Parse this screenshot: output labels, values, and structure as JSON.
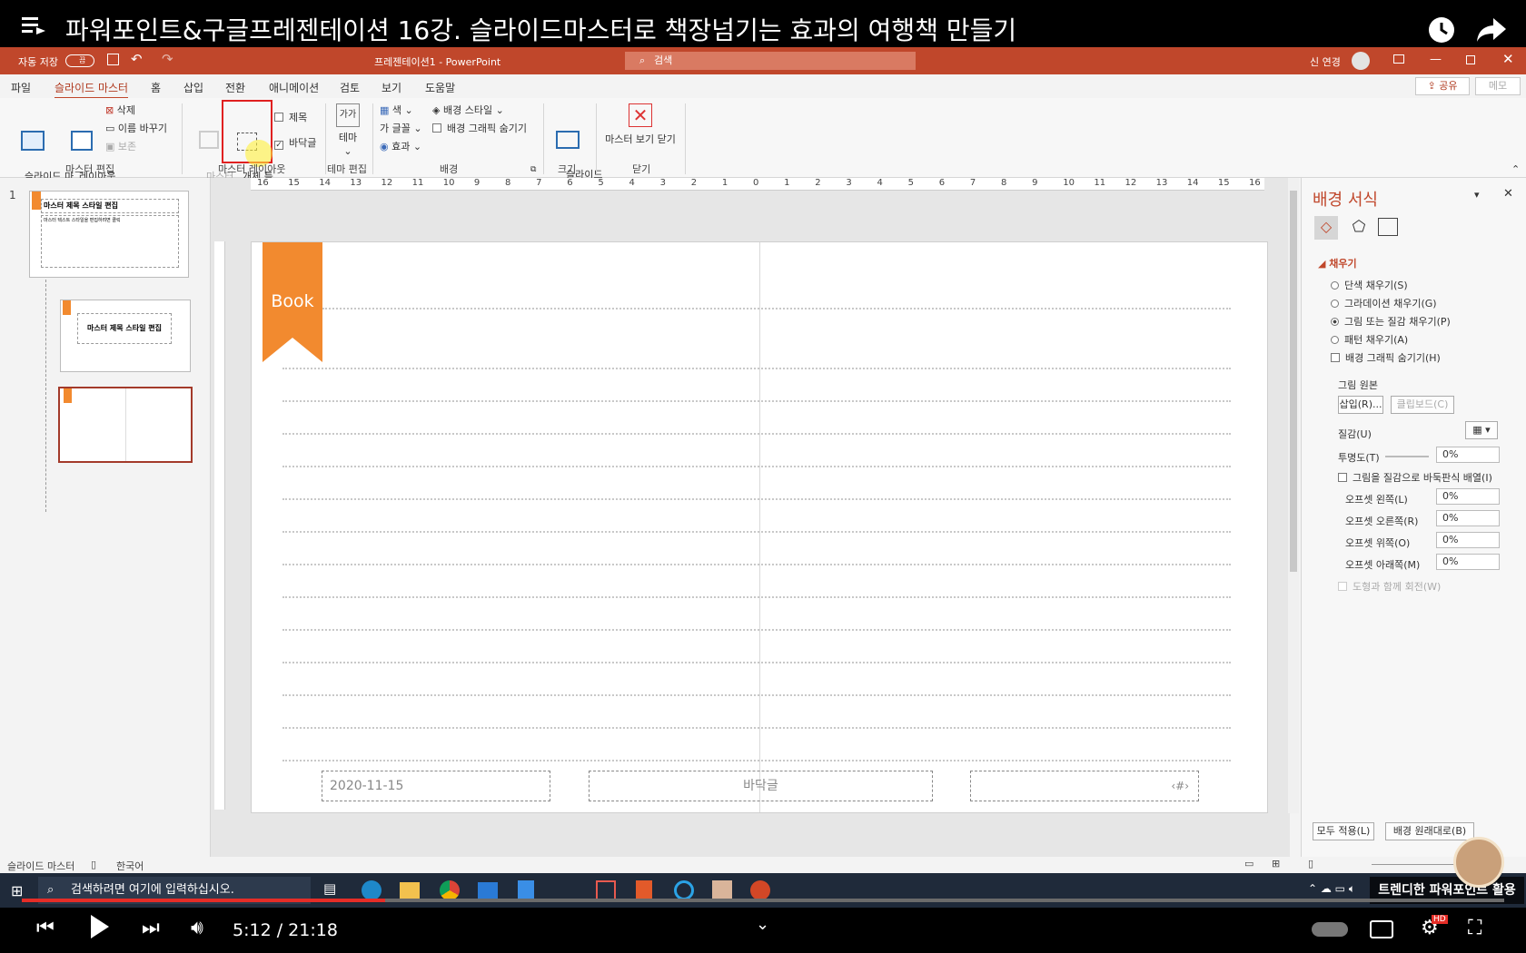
{
  "video": {
    "title": "파워포인트&구글프레젠테이션 16강. 슬라이드마스터로 책장넘기는 효과의 여행책 만들기",
    "time": "5:12 / 21:18",
    "watermark": "트렌디한 파워포인트 활용"
  },
  "titlebar": {
    "autosave": "자동 저장",
    "autosave_state": "끔",
    "doc_title": "프레젠테이션1 - PowerPoint",
    "search_placeholder": "검색",
    "user": "신 연경"
  },
  "tabs": [
    "파일",
    "슬라이드 마스터",
    "홈",
    "삽입",
    "전환",
    "애니메이션",
    "검토",
    "보기",
    "도움말"
  ],
  "share_label": "공유",
  "memo_label": "메모",
  "ribbon": {
    "insert_master": "슬라이드 마\n스터 삽입",
    "insert_layout": "레이아웃\n삽입",
    "delete": "삭제",
    "rename": "이름 바꾸기",
    "preserve": "보존",
    "group_edit_master": "마스터 편집",
    "master_layout": "마스터\n레이아웃",
    "insert_placeholder": "개체 틀\n삽입",
    "title_chk": "제목",
    "footer_chk": "바닥글",
    "group_master_layout": "마스터 레이아웃",
    "theme": "테마",
    "group_edit_theme": "테마 편집",
    "colors": "색",
    "fonts": "글꼴",
    "effects": "효과",
    "bg_styles": "배경 스타일",
    "hide_bg": "배경 그래픽 숨기기",
    "group_background": "배경",
    "slide_size": "슬라이드\n크기",
    "group_size": "크기",
    "close_master": "마스터 보기 닫기",
    "group_close": "닫기"
  },
  "ruler_labels": [
    "16",
    "15",
    "14",
    "13",
    "12",
    "11",
    "10",
    "9",
    "8",
    "7",
    "6",
    "5",
    "4",
    "3",
    "2",
    "1",
    "0",
    "1",
    "2",
    "3",
    "4",
    "5",
    "6",
    "7",
    "8",
    "9",
    "10",
    "11",
    "12",
    "13",
    "14",
    "15",
    "16"
  ],
  "thumbs": {
    "number": "1",
    "master_title": "마스터 제목 스타일 편집",
    "master_body": "마스터 텍스트 스타일을 편집하려면 클릭",
    "layout_title": "마스터 제목 스타일 편집"
  },
  "slide": {
    "bookmark_label": "Book",
    "date": "2020-11-15",
    "footer": "바닥글",
    "page_num": "‹#›"
  },
  "pane": {
    "title": "배경 서식",
    "section_fill": "채우기",
    "options": [
      {
        "label": "단색 채우기(S)",
        "checked": false
      },
      {
        "label": "그라데이션 채우기(G)",
        "checked": false
      },
      {
        "label": "그림 또는 질감 채우기(P)",
        "checked": true
      },
      {
        "label": "패턴 채우기(A)",
        "checked": false
      }
    ],
    "hide_bg": "배경 그래픽 숨기기(H)",
    "picture_source": "그림 원본",
    "insert_btn": "삽입(R)...",
    "clipboard_btn": "클립보드(C)",
    "texture": "질감(U)",
    "transparency": "투명도(T)",
    "transparency_value": "0%",
    "tile": "그림을 질감으로 바둑판식 배열(I)",
    "offsets": [
      {
        "label": "오프셋 왼쪽(L)",
        "value": "0%"
      },
      {
        "label": "오프셋 오른쪽(R)",
        "value": "0%"
      },
      {
        "label": "오프셋 위쪽(O)",
        "value": "0%"
      },
      {
        "label": "오프셋 아래쪽(M)",
        "value": "0%"
      }
    ],
    "rotate": "도형과 함께 회전(W)",
    "apply_all": "모두 적용(L)",
    "reset_bg": "배경 원래대로(B)"
  },
  "status": {
    "view": "슬라이드 마스터",
    "lang": "한국어"
  },
  "taskbar": {
    "search": "검색하려면 여기에 입력하십시오."
  },
  "colors": {
    "ppt_red": "#c0472b",
    "bookmark": "#f28a2f",
    "yt_red": "#e52d27"
  }
}
